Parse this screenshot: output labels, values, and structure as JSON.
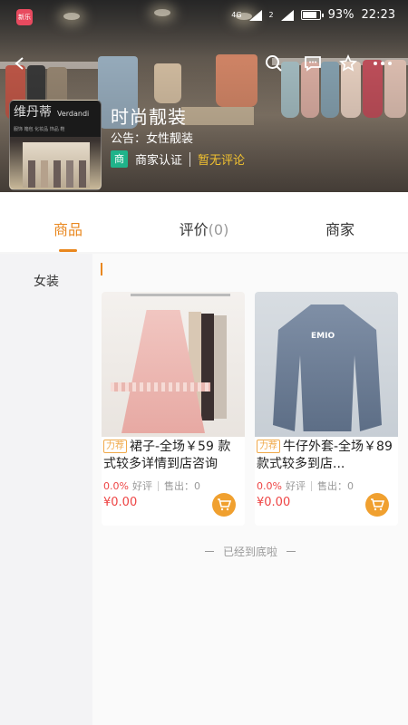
{
  "status_bar": {
    "app_badge": "新乐",
    "network": "4G",
    "sim2": "2",
    "battery": "93%",
    "time": "22:23",
    "battery_fill": 0.93
  },
  "store": {
    "logo_name_cn": "维丹蒂",
    "logo_name_en": "Verdandi",
    "logo_subtitle": "服饰 箱包 化妆品 饰品 鞋",
    "name": "时尚靓装",
    "notice": "公告：女性靓装",
    "cert_badge": "商",
    "cert_label": "商家认证",
    "review_status": "暂无评论"
  },
  "tabs": [
    {
      "label": "商品",
      "count": ""
    },
    {
      "label": "评价",
      "count": "(0)"
    },
    {
      "label": "商家",
      "count": ""
    }
  ],
  "categories": [
    "女装"
  ],
  "products": [
    {
      "tag": "力荐",
      "title": "裙子-全场￥59 款式较多详情到店咨询",
      "rating": "0.0%",
      "rating_label": "好评",
      "sold_label": "售出：0",
      "price": "¥0.00"
    },
    {
      "tag": "力荐",
      "title": "牛仔外套-全场￥89 款式较多到店...",
      "rating": "0.0%",
      "rating_label": "好评",
      "sold_label": "售出：0",
      "price": "¥0.00"
    }
  ],
  "end_text": "已经到底啦",
  "colors": {
    "accent": "#e9871e",
    "price": "#e44444",
    "cert": "#1fb38a",
    "review": "#f2c230"
  }
}
